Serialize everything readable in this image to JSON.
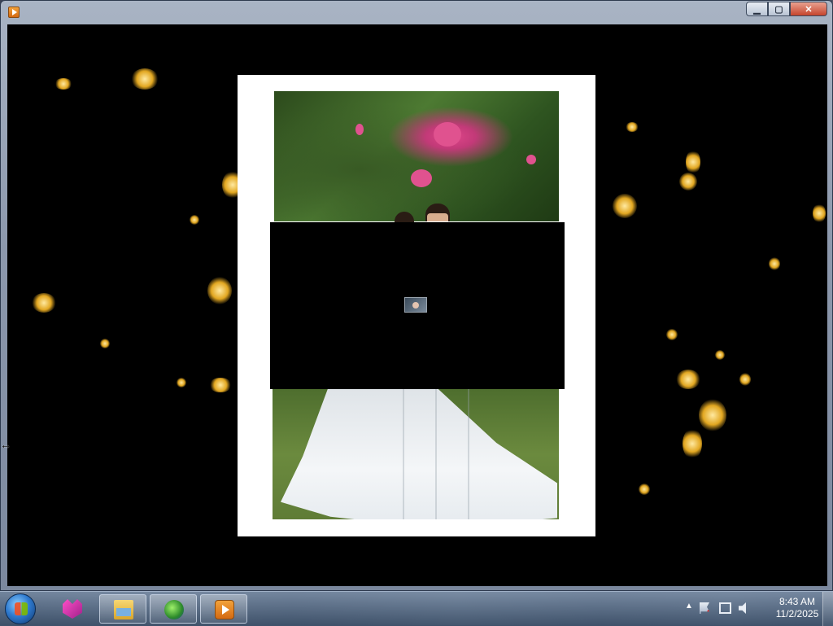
{
  "window": {
    "app_icon": "media-player-icon",
    "caption_buttons": {
      "minimize": "▁",
      "maximize": "▢",
      "close": "✕"
    }
  },
  "viewer": {
    "content": "slideshow-frame",
    "overlay_thumbnail_icon": "photo-thumbnail-icon"
  },
  "taskbar": {
    "start_icon": "windows-start-orb",
    "pinned": [
      {
        "name": "cat-app-icon",
        "active": false
      },
      {
        "name": "file-explorer-icon",
        "active": true
      },
      {
        "name": "download-manager-icon",
        "active": true
      },
      {
        "name": "media-player-icon",
        "active": true
      }
    ],
    "tray": {
      "show_hidden_icons": "▲",
      "icons": [
        "action-center-icon",
        "network-icon",
        "volume-muted-icon"
      ]
    },
    "clock": {
      "time": "8:43 AM",
      "date": "11/2/2025"
    }
  }
}
